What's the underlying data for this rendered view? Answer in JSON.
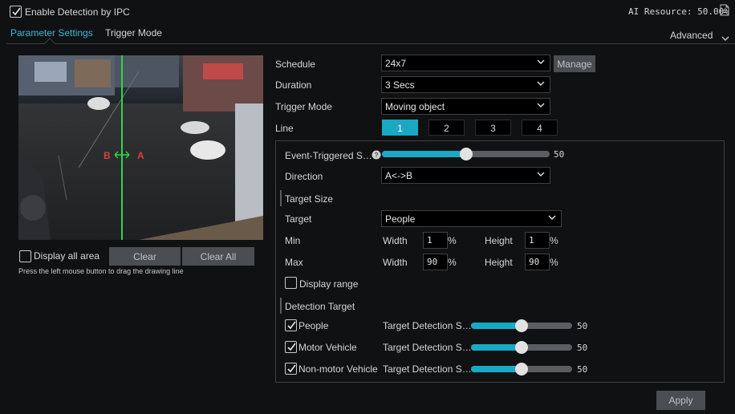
{
  "header": {
    "enable_label": "Enable Detection by IPC",
    "enable_checked": true,
    "ai_resource": "AI Resource: 50.00%"
  },
  "tabs": {
    "parameter": "Parameter Settings",
    "trigger": "Trigger Mode",
    "advanced": "Advanced"
  },
  "preview": {
    "label_b": "B",
    "label_a": "A",
    "display_all_area": "Display all area",
    "clear": "Clear",
    "clear_all": "Clear All",
    "hint": "Press the left mouse button to drag the drawing line"
  },
  "form": {
    "schedule_label": "Schedule",
    "schedule_value": "24x7",
    "manage": "Manage",
    "duration_label": "Duration",
    "duration_value": "3 Secs",
    "trigger_mode_label": "Trigger Mode",
    "trigger_mode_value": "Moving object",
    "line_label": "Line",
    "lines": [
      "1",
      "2",
      "3",
      "4"
    ],
    "active_line": "1"
  },
  "line_panel": {
    "sensitivity_label": "Event-Triggered S…",
    "sensitivity_value": 50,
    "direction_label": "Direction",
    "direction_value": "A<->B",
    "target_size_title": "Target Size",
    "target_label": "Target",
    "target_value": "People",
    "min_label": "Min",
    "max_label": "Max",
    "width_label": "Width",
    "height_label": "Height",
    "min_width": "1",
    "min_height": "1",
    "max_width": "90",
    "max_height": "90",
    "percent": "%",
    "display_range": "Display range",
    "detection_target_title": "Detection Target",
    "targets": [
      {
        "name": "People",
        "checked": true,
        "sens_label": "Target Detection S…",
        "value": 50
      },
      {
        "name": "Motor Vehicle",
        "checked": true,
        "sens_label": "Target Detection S…",
        "value": 50
      },
      {
        "name": "Non-motor Vehicle",
        "checked": true,
        "sens_label": "Target Detection S…",
        "value": 50
      }
    ]
  },
  "apply": "Apply",
  "colors": {
    "accent": "#1aa8c4",
    "background": "#101113",
    "panel_border": "#3d3f43"
  }
}
